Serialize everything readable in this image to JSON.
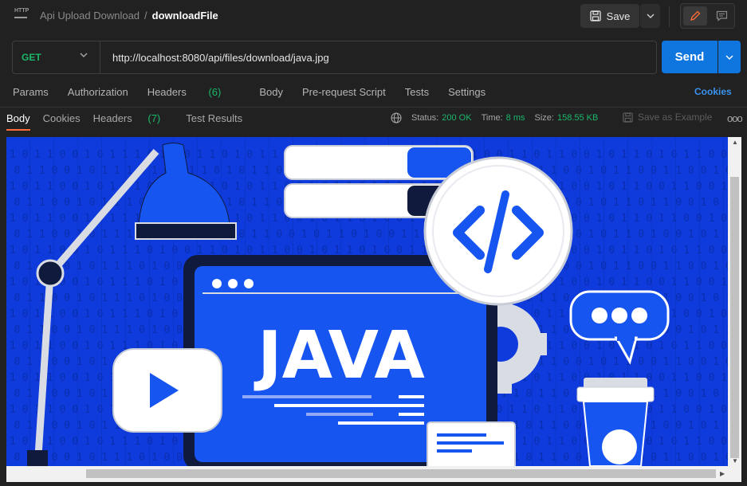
{
  "header": {
    "breadcrumb_parent": "Api Upload Download",
    "breadcrumb_separator": "/",
    "breadcrumb_current": "downloadFile",
    "http_icon_label": "HTTP",
    "save_label": "Save"
  },
  "request": {
    "method": "GET",
    "url": "http://localhost:8080/api/files/download/java.jpg",
    "send_label": "Send"
  },
  "request_tabs": {
    "params": "Params",
    "authorization": "Authorization",
    "headers": "Headers",
    "headers_count": "(6)",
    "body": "Body",
    "prerequest": "Pre-request Script",
    "tests": "Tests",
    "settings": "Settings",
    "cookies": "Cookies"
  },
  "response_tabs": {
    "body": "Body",
    "cookies": "Cookies",
    "headers": "Headers",
    "headers_count": "(7)",
    "test_results": "Test Results"
  },
  "response_meta": {
    "status_label": "Status:",
    "status_value": "200 OK",
    "time_label": "Time:",
    "time_value": "8 ms",
    "size_label": "Size:",
    "size_value": "158.55 KB",
    "save_example": "Save as Example",
    "more": "ooo"
  },
  "preview": {
    "image_word": "JAVA",
    "code_symbol": "</>",
    "binary_row": "1 0 1 1 0 0 1 0 1 1 1 0 1 0 0 1 1 0 1 0 1 1 0 0 1 0 1 1 0 1 0 0 1 1 0 1 0 1 0 0 1 1 0 1 1 0 0 1 0 1 1 0"
  },
  "colors": {
    "accent_orange": "#ff6c37",
    "send_blue": "#0f76e0",
    "status_green": "#1bb86a",
    "image_blue": "#0f3bdc"
  }
}
